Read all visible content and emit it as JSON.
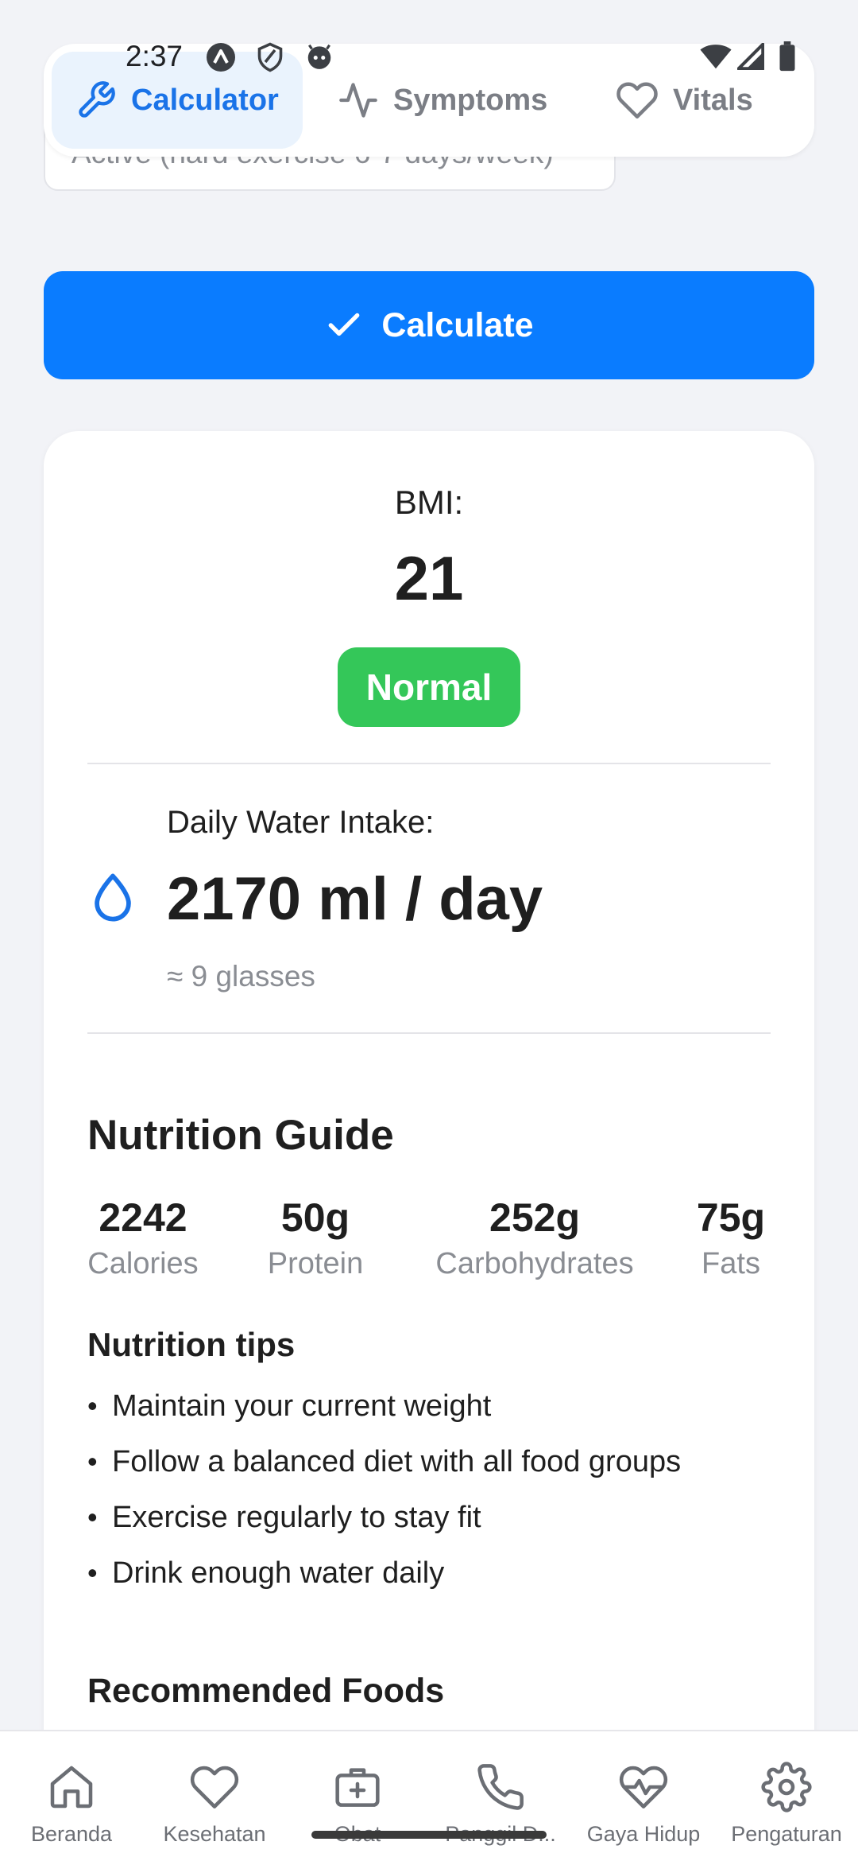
{
  "status_bar": {
    "time": "2:37"
  },
  "activity_select": {
    "value": "Active (hard exercise 6-7 days/week)"
  },
  "top_tabs": [
    {
      "label": "Calculator",
      "icon": "wrench-icon",
      "active": true
    },
    {
      "label": "Symptoms",
      "icon": "activity-icon",
      "active": false
    },
    {
      "label": "Vitals",
      "icon": "heart-icon",
      "active": false
    }
  ],
  "calculate_button": {
    "label": "Calculate",
    "icon": "check-icon"
  },
  "results": {
    "bmi_label": "BMI:",
    "bmi_value": "21",
    "bmi_status": "Normal",
    "water_label": "Daily Water Intake:",
    "water_value": "2170 ml / day",
    "water_sub": "≈ 9 glasses"
  },
  "nutrition": {
    "title": "Nutrition Guide",
    "macros": [
      {
        "value": "2242",
        "label": "Calories"
      },
      {
        "value": "50g",
        "label": "Protein"
      },
      {
        "value": "252g",
        "label": "Carbohydrates"
      },
      {
        "value": "75g",
        "label": "Fats"
      }
    ],
    "tips_title": "Nutrition tips",
    "tips": [
      "Maintain your current weight",
      "Follow a balanced diet with all food groups",
      "Exercise regularly to stay fit",
      "Drink enough water daily"
    ],
    "recommended_title": "Recommended Foods"
  },
  "bottom_nav": [
    {
      "label": "Beranda",
      "icon": "home-icon"
    },
    {
      "label": "Kesehatan",
      "icon": "heart-icon"
    },
    {
      "label": "Obat",
      "icon": "medkit-icon"
    },
    {
      "label": "Panggil D...",
      "icon": "phone-icon"
    },
    {
      "label": "Gaya Hidup",
      "icon": "heart-pulse-icon"
    },
    {
      "label": "Pengaturan",
      "icon": "gear-icon"
    }
  ],
  "colors": {
    "accent": "#0a7cff",
    "tab_active": "#1a73e8",
    "status_normal": "#34c759",
    "background": "#f2f3f7"
  }
}
